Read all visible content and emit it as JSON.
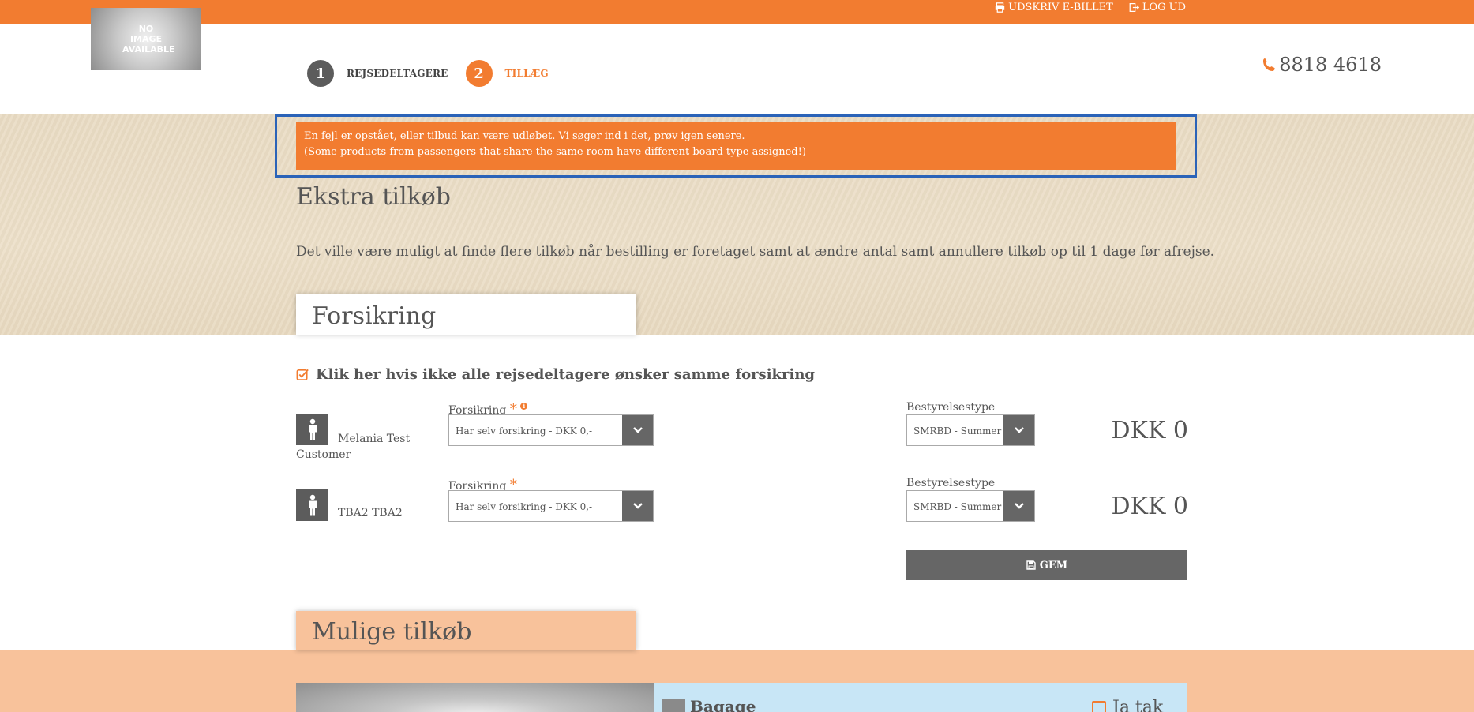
{
  "topbar": {
    "print_label": "UDSKRIV E-BILLET",
    "logout_label": "LOG UD"
  },
  "logo": {
    "text": "NO IMAGE AVAILABLE"
  },
  "steps": [
    {
      "number": "1",
      "label": "REJSEDELTAGERE",
      "state": "done"
    },
    {
      "number": "2",
      "label": "TILLÆG",
      "state": "active"
    }
  ],
  "phone": "8818 4618",
  "error": {
    "line1": "En fejl er opstået, eller tilbud kan være udløbet. Vi søger ind i det, prøv igen senere.",
    "line2": "(Some products from passengers that share the same room have different board type assigned!)"
  },
  "page_title": "Ekstra tilkøb",
  "intro": "Det ville være muligt at finde flere tilkøb når bestilling er foretaget samt at ændre antal samt annullere tilkøb op til 1 dage før afrejse.",
  "insurance": {
    "tab_label": "Forsikring",
    "checkbox_label": "Klik her hvis ikke alle rejsedeltagere ønsker samme forsikring",
    "insurance_label": "Forsikring",
    "required_mark": "*",
    "info_mark": "i",
    "board_label": "Bestyrelsestype",
    "passengers": [
      {
        "name": "Melania Test Customer",
        "insurance": "Har selv forsikring - DKK 0,-",
        "board": "SMRBD - Summer board",
        "price": "DKK 0"
      },
      {
        "name": "TBA2 TBA2",
        "insurance": "Har selv forsikring - DKK 0,-",
        "board": "SMRBD - Summer board",
        "price": "DKK 0"
      }
    ],
    "save_label": "GEM"
  },
  "addons": {
    "tab_label": "Mulige tilkøb",
    "item_title": "Bagage",
    "item_check_label": "Ja tak"
  },
  "colors": {
    "accent": "#f27c30",
    "dark": "#5c5c5c",
    "sand": "#e9dbc3",
    "peach": "#f8c29b",
    "light_blue": "#c8e6f6",
    "highlight_border": "#2b63b8"
  }
}
